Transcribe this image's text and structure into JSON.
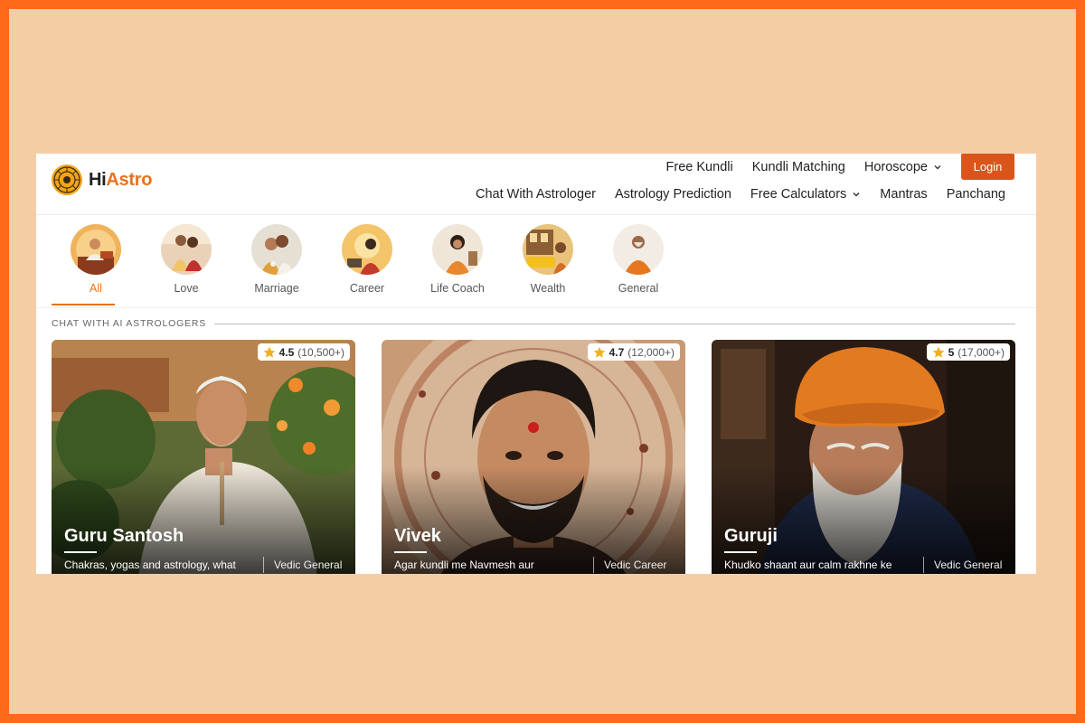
{
  "brand": {
    "logo_hi": "Hi",
    "logo_astro": "Astro"
  },
  "nav_top": {
    "free_kundli": "Free Kundli",
    "kundli_matching": "Kundli Matching",
    "horoscope": "Horoscope",
    "login": "Login"
  },
  "nav_bottom": {
    "chat": "Chat With Astrologer",
    "prediction": "Astrology Prediction",
    "calculators": "Free Calculators",
    "mantras": "Mantras",
    "panchang": "Panchang"
  },
  "categories": [
    {
      "label": "All",
      "active": true
    },
    {
      "label": "Love"
    },
    {
      "label": "Marriage"
    },
    {
      "label": "Career"
    },
    {
      "label": "Life Coach"
    },
    {
      "label": "Wealth"
    },
    {
      "label": "General"
    }
  ],
  "section_title": "CHAT WITH AI ASTROLOGERS",
  "astrologers": [
    {
      "name": "Guru Santosh",
      "rating": "4.5",
      "reviews": "(10,500+)",
      "desc": "Chakras, yogas and astrology, what",
      "tag": "Vedic General"
    },
    {
      "name": "Vivek",
      "rating": "4.7",
      "reviews": "(12,000+)",
      "desc": "Agar kundli me Navmesh aur",
      "tag": "Vedic Career"
    },
    {
      "name": "Guruji",
      "rating": "5",
      "reviews": "(17,000+)",
      "desc": "Khudko shaant aur calm rakhne ke",
      "tag": "Vedic General"
    }
  ],
  "colors": {
    "accent": "#e8731f",
    "login_bg": "#d9551a",
    "frame": "#ff6a1a",
    "backdrop": "#f5cda5"
  }
}
